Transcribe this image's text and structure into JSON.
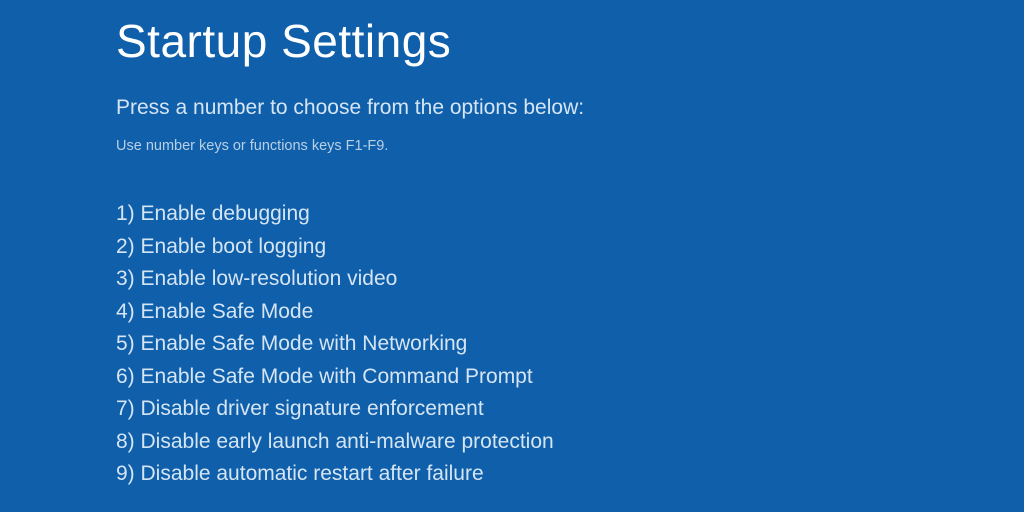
{
  "title": "Startup Settings",
  "subtitle": "Press a number to choose from the options below:",
  "hint": "Use number keys or functions keys F1-F9.",
  "options": [
    "1) Enable debugging",
    "2) Enable boot logging",
    "3) Enable low-resolution video",
    "4) Enable Safe Mode",
    "5) Enable Safe Mode with Networking",
    "6) Enable Safe Mode with Command Prompt",
    "7) Disable driver signature enforcement",
    "8) Disable early launch anti-malware protection",
    "9) Disable automatic restart after failure"
  ]
}
